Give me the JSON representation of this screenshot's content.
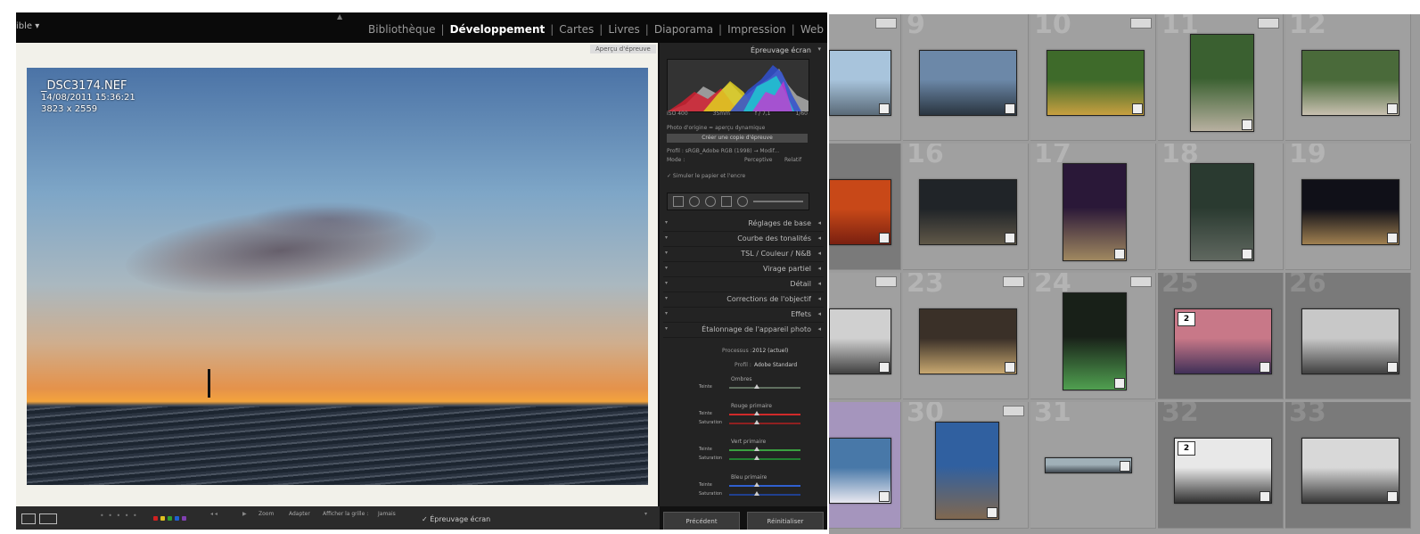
{
  "develop": {
    "identity_label": "ible ▾",
    "modules": [
      {
        "label": "Bibliothèque",
        "active": false
      },
      {
        "label": "Développement",
        "active": true
      },
      {
        "label": "Cartes",
        "active": false
      },
      {
        "label": "Livres",
        "active": false
      },
      {
        "label": "Diaporama",
        "active": false
      },
      {
        "label": "Impression",
        "active": false
      },
      {
        "label": "Web",
        "active": false
      }
    ],
    "photo_info": {
      "filename": "_DSC3174.NEF",
      "datetime": "14/08/2011 15:36:21",
      "dimensions": "3823 x 2559"
    },
    "softproof_badge": "Aperçu d'épreuve",
    "panel_header": "Épreuvage écran",
    "histogram_labels": [
      "ISO 400",
      "35mm",
      "f / 7,1",
      "1/60"
    ],
    "small_lines": {
      "target": "Photo d'origine = aperçu dynamique",
      "copy_button": "Créer une copie d'épreuve",
      "profile": "Profil : sRGB_Adobe RGB (1998) → Modif...",
      "mode": "Mode :",
      "mode_values": [
        "Perceptive",
        "Relatif"
      ],
      "simulate": "✓ Simuler le papier et l'encre"
    },
    "panels": [
      {
        "label": "Réglages de base"
      },
      {
        "label": "Courbe des tonalités"
      },
      {
        "label": "TSL / Couleur / N&B"
      },
      {
        "label": "Virage partiel"
      },
      {
        "label": "Détail"
      },
      {
        "label": "Corrections de l'objectif"
      },
      {
        "label": "Effets"
      },
      {
        "label": "Étalonnage de l'appareil photo"
      }
    ],
    "calibration": {
      "process_label": "Processus :",
      "process_value": "2012 (actuel)",
      "profile_label": "Profil :",
      "profile_value": "Adobe Standard",
      "groups": [
        {
          "name": "Ombres",
          "sliders": [
            "Teinte"
          ]
        },
        {
          "name": "Rouge primaire",
          "sliders": [
            "Teinte",
            "Saturation"
          ]
        },
        {
          "name": "Vert primaire",
          "sliders": [
            "Teinte",
            "Saturation"
          ]
        },
        {
          "name": "Bleu primaire",
          "sliders": [
            "Teinte",
            "Saturation"
          ]
        }
      ]
    },
    "bottom": {
      "zoom_label": "Zoom",
      "fit_label": "Adapter",
      "grid_label": "Afficher la grille :",
      "grid_value": "Jamais",
      "softproof": "✓ Épreuvage écran",
      "prev_button": "Précédent",
      "reset_button": "Réinitialiser"
    },
    "colors": {
      "labels": [
        "#d02020",
        "#e0c020",
        "#30a030",
        "#2060d0",
        "#8040b0"
      ]
    }
  },
  "library": {
    "cells": [
      {
        "number": "",
        "row": 0,
        "col": 0,
        "kind": "photo",
        "has_flag": true,
        "palette": [
          "#a8c4dc",
          "#5a6a78"
        ]
      },
      {
        "number": "9",
        "row": 0,
        "col": 1,
        "kind": "photo",
        "has_flag": false,
        "palette": [
          "#6c88a8",
          "#2a3540"
        ]
      },
      {
        "number": "10",
        "row": 0,
        "col": 2,
        "kind": "photo",
        "has_flag": true,
        "palette": [
          "#3e6a2a",
          "#c8a040"
        ]
      },
      {
        "number": "11",
        "row": 0,
        "col": 3,
        "kind": "photo",
        "has_flag": true,
        "palette": [
          "#3a6030",
          "#b8b0a0"
        ]
      },
      {
        "number": "12",
        "row": 0,
        "col": 4,
        "kind": "photo",
        "has_flag": false,
        "palette": [
          "#4a6a3a",
          "#c8c0b0"
        ]
      },
      {
        "number": "",
        "row": 1,
        "col": 0,
        "kind": "photo",
        "has_flag": false,
        "dark": true,
        "palette": [
          "#c84818",
          "#7a2010"
        ]
      },
      {
        "number": "16",
        "row": 1,
        "col": 1,
        "kind": "photo",
        "has_flag": false,
        "palette": [
          "#202428",
          "#605848"
        ]
      },
      {
        "number": "17",
        "row": 1,
        "col": 2,
        "kind": "photo",
        "has_flag": false,
        "palette": [
          "#2a1838",
          "#a08860"
        ]
      },
      {
        "number": "18",
        "row": 1,
        "col": 3,
        "kind": "photo",
        "has_flag": false,
        "palette": [
          "#2a3a30",
          "#606860"
        ]
      },
      {
        "number": "19",
        "row": 1,
        "col": 4,
        "kind": "photo",
        "has_flag": false,
        "palette": [
          "#101018",
          "#a08050"
        ]
      },
      {
        "number": "",
        "row": 2,
        "col": 0,
        "kind": "photo",
        "has_flag": true,
        "palette": [
          "#d0d0d0",
          "#404040"
        ]
      },
      {
        "number": "23",
        "row": 2,
        "col": 1,
        "kind": "photo",
        "has_flag": true,
        "palette": [
          "#3a3028",
          "#c8a870"
        ]
      },
      {
        "number": "24",
        "row": 2,
        "col": 2,
        "kind": "photo",
        "has_flag": true,
        "palette": [
          "#182018",
          "#50a050"
        ]
      },
      {
        "number": "25",
        "row": 2,
        "col": 3,
        "kind": "photo",
        "has_flag": false,
        "dark": true,
        "stack": "2",
        "palette": [
          "#c87888",
          "#403058"
        ]
      },
      {
        "number": "26",
        "row": 2,
        "col": 4,
        "kind": "photo",
        "has_flag": false,
        "dark": true,
        "palette": [
          "#c8c8c8",
          "#404040"
        ]
      },
      {
        "number": "",
        "row": 3,
        "col": 0,
        "kind": "photo",
        "has_flag": false,
        "sel": true,
        "palette": [
          "#4878a8",
          "#e8e8f0"
        ]
      },
      {
        "number": "30",
        "row": 3,
        "col": 1,
        "kind": "photo",
        "has_flag": true,
        "palette": [
          "#3060a0",
          "#806850"
        ]
      },
      {
        "number": "31",
        "row": 3,
        "col": 2,
        "kind": "photo",
        "has_flag": false,
        "palette": [
          "#a0b0b8",
          "#404850"
        ]
      },
      {
        "number": "32",
        "row": 3,
        "col": 3,
        "kind": "photo",
        "has_flag": false,
        "dark": true,
        "stack": "2",
        "palette": [
          "#e8e8e8",
          "#303030"
        ]
      },
      {
        "number": "33",
        "row": 3,
        "col": 4,
        "kind": "photo",
        "has_flag": false,
        "dark": true,
        "palette": [
          "#d8d8d8",
          "#383838"
        ]
      }
    ]
  }
}
